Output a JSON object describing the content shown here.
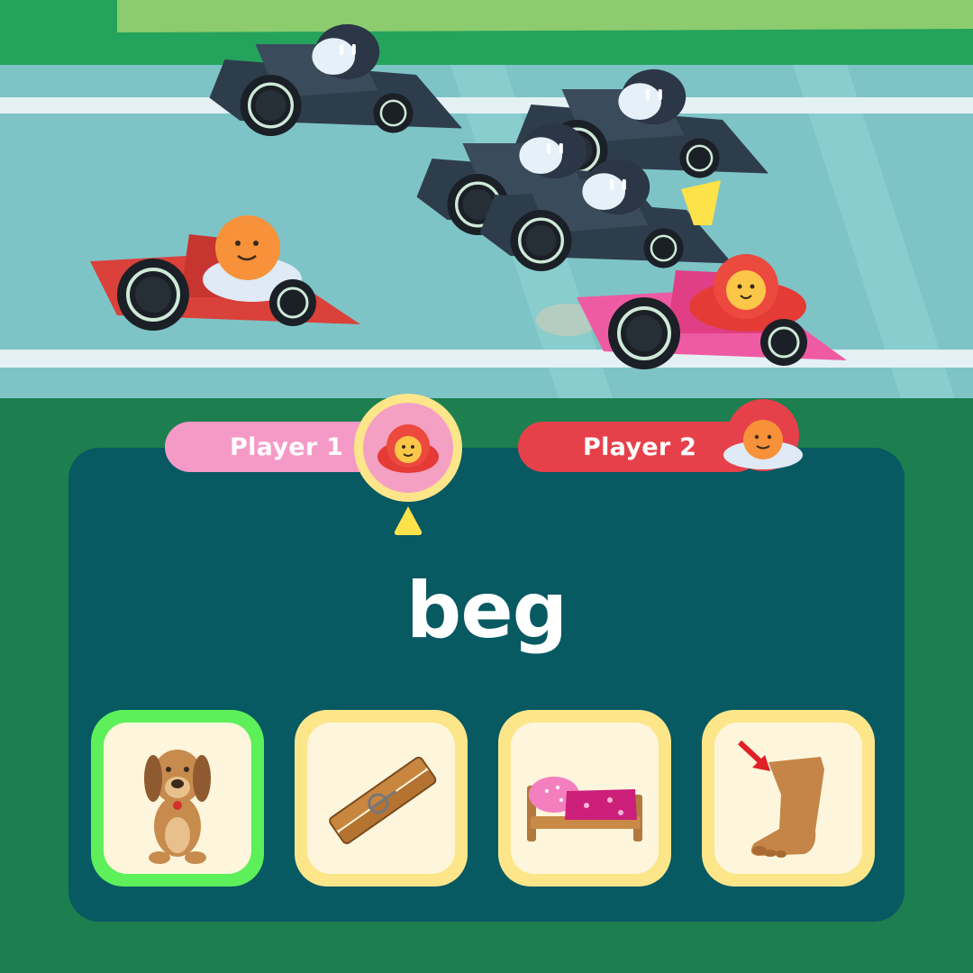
{
  "players": [
    {
      "label": "Player 1",
      "color": "#f59ac7",
      "active": true
    },
    {
      "label": "Player 2",
      "color": "#e6414a",
      "active": false
    }
  ],
  "question": {
    "word": "beg"
  },
  "answers": [
    {
      "name": "dog-begging-icon",
      "selected": true
    },
    {
      "name": "clothespin-icon",
      "selected": false
    },
    {
      "name": "bed-icon",
      "selected": false
    },
    {
      "name": "leg-icon",
      "selected": false
    }
  ],
  "colors": {
    "grass": "#1d7f4f",
    "track": "#7ec4c7",
    "panel": "#075962",
    "card_border": "#fde68a",
    "selected_border": "#5ef05a"
  }
}
